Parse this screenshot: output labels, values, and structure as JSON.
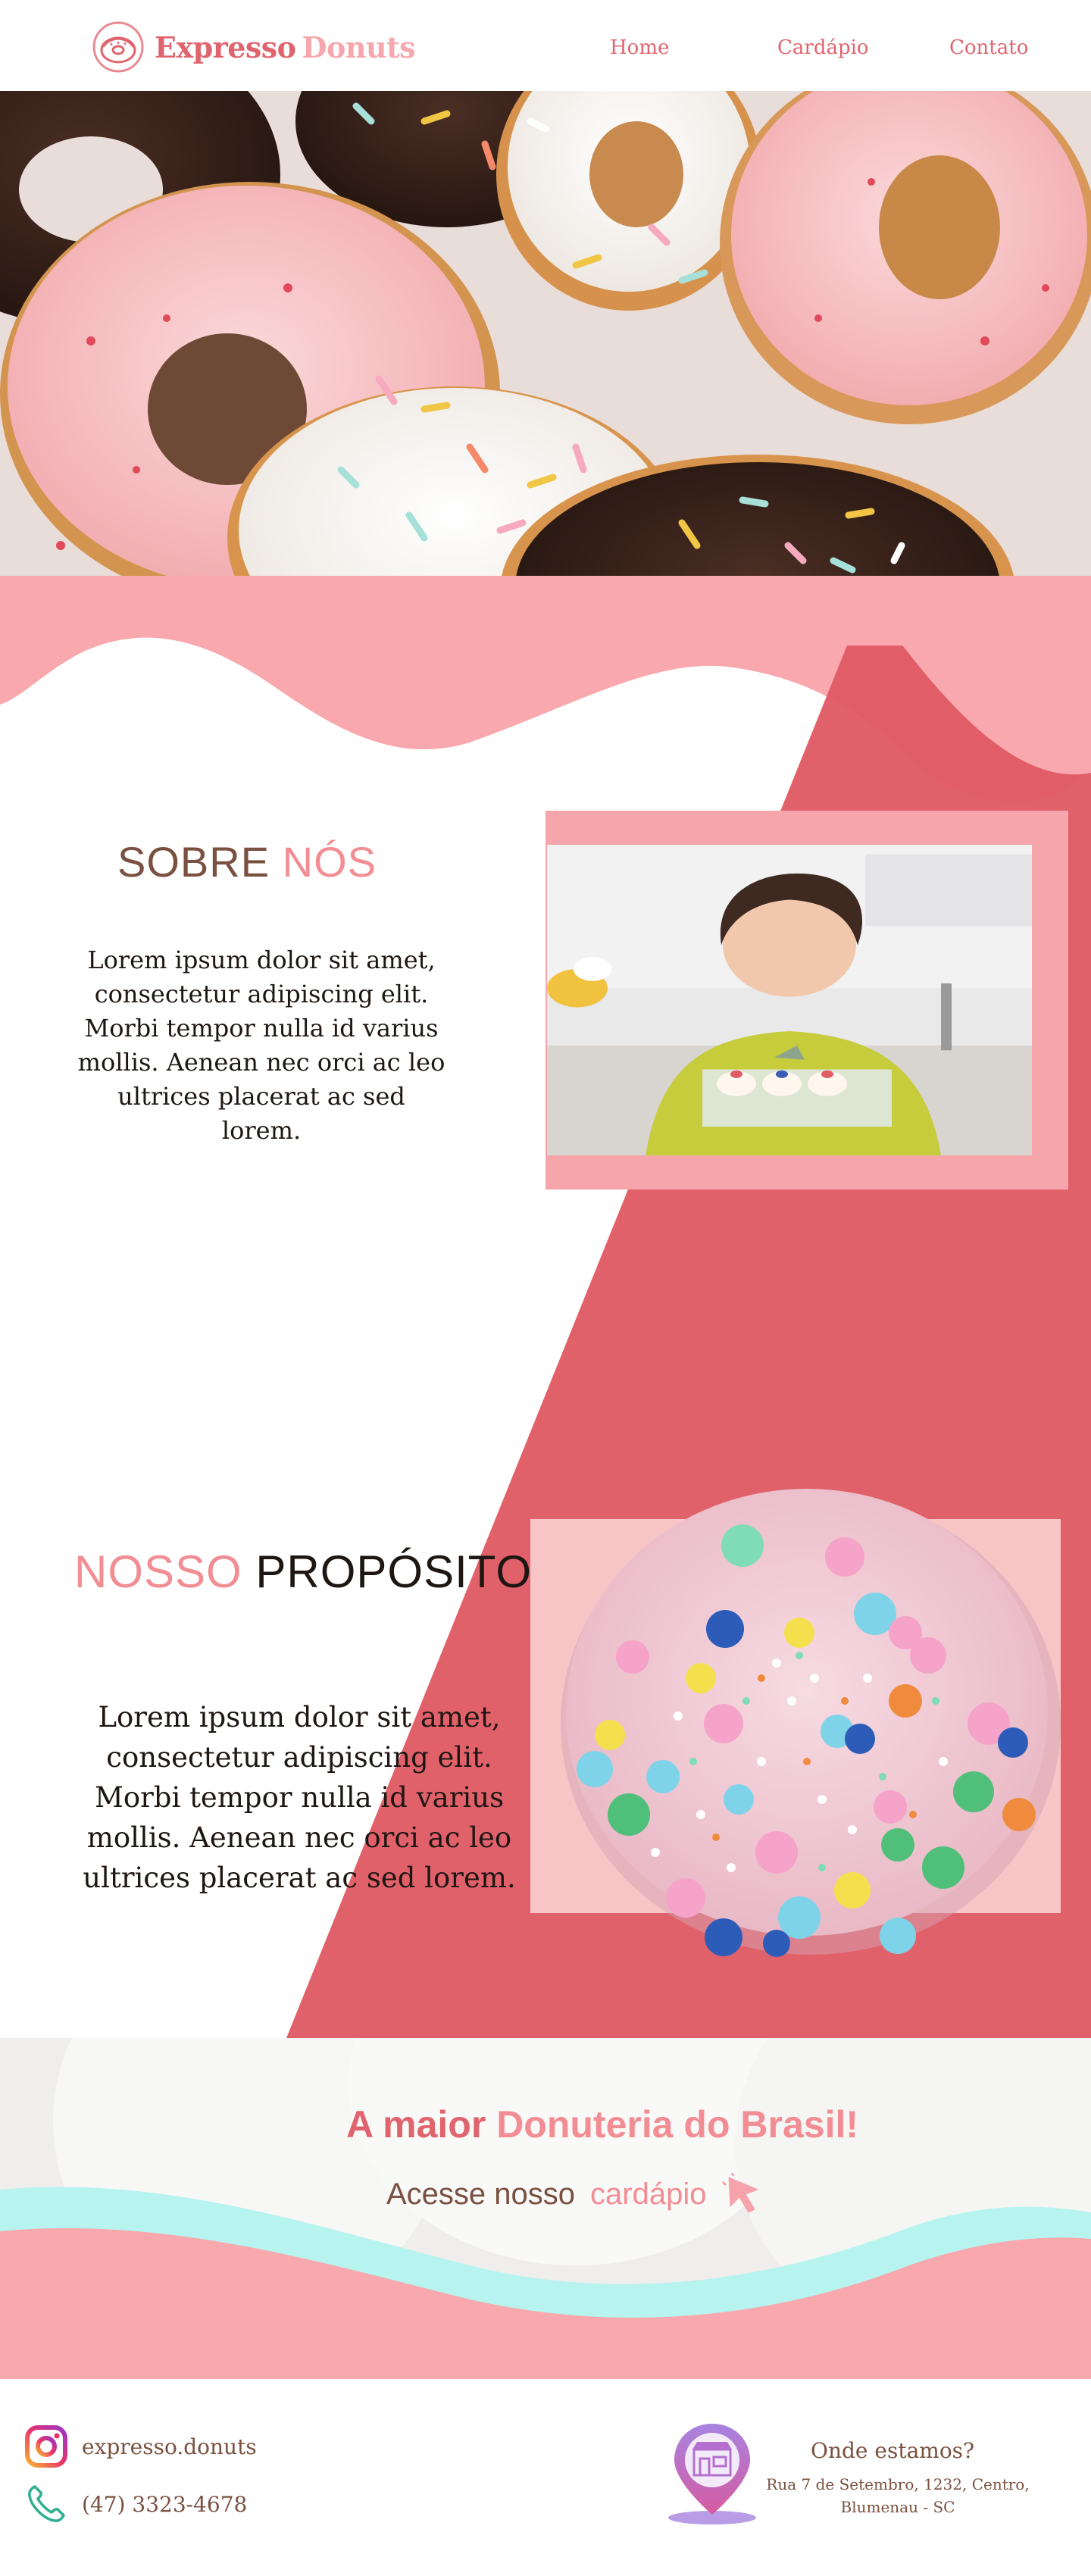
{
  "brand": {
    "name_part1": "Expresso",
    "name_part2": "Donuts",
    "colors": {
      "primary": "#e0646e",
      "light": "#f6a7ae",
      "brown": "#7a5040",
      "mint": "#b7f3ef"
    }
  },
  "nav": {
    "items": [
      {
        "label": "Home"
      },
      {
        "label": "Cardápio"
      },
      {
        "label": "Contato"
      }
    ]
  },
  "about": {
    "title_part1": "SOBRE",
    "title_part2": "NÓS",
    "text": "Lorem ipsum dolor sit amet, consectetur adipiscing elit. Morbi tempor nulla id varius mollis. Aenean nec orci ac leo ultrices placerat ac sed lorem."
  },
  "purpose": {
    "title_part1": "NOSSO",
    "title_part2": "PROPÓSITO",
    "text": "Lorem ipsum dolor sit amet, consectetur adipiscing elit. Morbi tempor nulla id varius mollis. Aenean nec orci ac leo ultrices placerat ac sed lorem."
  },
  "cta": {
    "title_part1": "A maior",
    "title_part2": "Donuteria do Brasil!",
    "line_part1": "Acesse  nosso",
    "line_part2": "cardápio"
  },
  "footer": {
    "instagram": "expresso.donuts",
    "phone": "(47) 3323-4678",
    "location_title": "Onde estamos?",
    "address": "Rua 7 de Setembro, 1232, Centro, Blumenau - SC"
  },
  "icons": [
    "donut-logo-icon",
    "cursor-click-icon",
    "instagram-icon",
    "phone-icon",
    "store-pin-icon"
  ]
}
